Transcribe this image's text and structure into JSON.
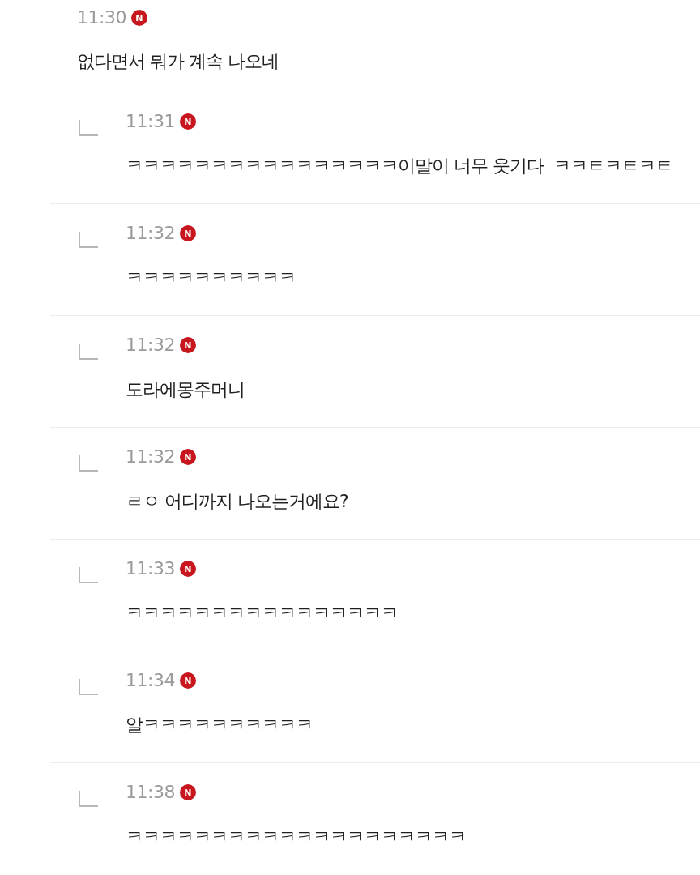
{
  "comment": {
    "time": "11:30",
    "badge": "N",
    "text": "없다면서 뭐가 계속 나오네",
    "replies": [
      {
        "time": "11:31",
        "badge": "N",
        "text": "ㅋㅋㅋㅋㅋㅋㅋㅋㅋㅋㅋㅋㅋㅋㅋㅋ이말이 너무 웃기다  ㅋㅋㅌㅋㅌㅋㅌ"
      },
      {
        "time": "11:32",
        "badge": "N",
        "text": "ㅋㅋㅋㅋㅋㅋㅋㅋㅋㅋ"
      },
      {
        "time": "11:32",
        "badge": "N",
        "text": "도라에몽주머니"
      },
      {
        "time": "11:32",
        "badge": "N",
        "text": "ㄹㅇ 어디까지 나오는거에요?"
      },
      {
        "time": "11:33",
        "badge": "N",
        "text": "ㅋㅋㅋㅋㅋㅋㅋㅋㅋㅋㅋㅋㅋㅋㅋㅋ"
      },
      {
        "time": "11:34",
        "badge": "N",
        "text": "알ㅋㅋㅋㅋㅋㅋㅋㅋㅋㅋ"
      },
      {
        "time": "11:38",
        "badge": "N",
        "text": "ㅋㅋㅋㅋㅋㅋㅋㅋㅋㅋㅋㅋㅋㅋㅋㅋㅋㅋㅋㅋ"
      }
    ]
  }
}
